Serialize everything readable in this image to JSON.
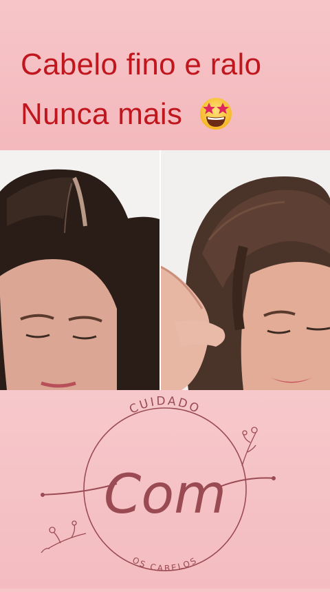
{
  "headline": {
    "line1": "Cabelo fino e ralo",
    "line2": "Nunca mais",
    "emoji_icon": "star-struck-emoji"
  },
  "photos": {
    "before_label_icon": "woman-thin-hair-photo",
    "after_label_icon": "woman-full-hair-photo"
  },
  "logo": {
    "top_text": "CUIDADO",
    "script_text": "Com",
    "bottom_text": "OS CABELOS",
    "color": "#9a4a52"
  },
  "colors": {
    "headline_text": "#c0161d",
    "background": "#f6c6c9"
  }
}
